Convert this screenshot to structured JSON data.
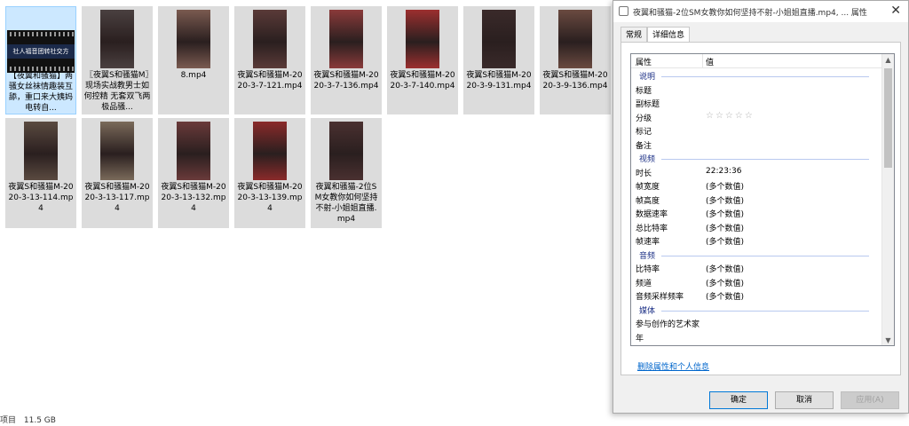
{
  "files": [
    {
      "name": "【夜翼和骚猫】两骚女丝袜情趣装互舔，重口来大姨妈电转自...",
      "band_text": "社人福音团转社交方",
      "selected": true
    },
    {
      "name": "〖夜翼S和骚猫M〗现场实战教男士如何控精 无套双飞两极品骚...",
      "selected": false
    },
    {
      "name": "8.mp4",
      "selected": false
    },
    {
      "name": "夜翼S和骚猫M-2020-3-7-121.mp4",
      "selected": false
    },
    {
      "name": "夜翼S和骚猫M-2020-3-7-136.mp4",
      "selected": false
    },
    {
      "name": "夜翼S和骚猫M-2020-3-7-140.mp4",
      "selected": false
    },
    {
      "name": "夜翼S和骚猫M-2020-3-9-131.mp4",
      "selected": false
    },
    {
      "name": "夜翼S和骚猫M-2020-3-9-136.mp4",
      "selected": false
    },
    {
      "name": "夜翼S和骚猫M-2020-3-13-114.mp4",
      "selected": false
    },
    {
      "name": "夜翼S和骚猫M-2020-3-13-117.mp4",
      "selected": false
    },
    {
      "name": "夜翼S和骚猫M-2020-3-13-132.mp4",
      "selected": false
    },
    {
      "name": "夜翼S和骚猫M-2020-3-13-139.mp4",
      "selected": false
    },
    {
      "name": "夜翼和骚猫-2位SM女教你如何坚持不射-小姐姐直播.mp4",
      "selected": false
    }
  ],
  "status_bar": {
    "items_label": "项目",
    "size": "11.5 GB"
  },
  "dialog": {
    "title": "夜翼和骚猫-2位SM女教你如何坚持不射-小姐姐直播.mp4, ... 属性",
    "close_glyph": "✕",
    "tabs": [
      {
        "label": "常规"
      },
      {
        "label": "详细信息"
      }
    ],
    "active_tab": "详细信息",
    "columns": {
      "property": "属性",
      "value": "值"
    },
    "rows": [
      {
        "type": "group",
        "name": "说明"
      },
      {
        "type": "prop",
        "name": "标题",
        "value": ""
      },
      {
        "type": "prop",
        "name": "副标题",
        "value": ""
      },
      {
        "type": "stars",
        "name": "分级",
        "value": "☆☆☆☆☆"
      },
      {
        "type": "prop",
        "name": "标记",
        "value": ""
      },
      {
        "type": "prop",
        "name": "备注",
        "value": ""
      },
      {
        "type": "group",
        "name": "视频"
      },
      {
        "type": "prop",
        "name": "时长",
        "value": "22:23:36"
      },
      {
        "type": "prop",
        "name": "帧宽度",
        "value": "(多个数值)"
      },
      {
        "type": "prop",
        "name": "帧高度",
        "value": "(多个数值)"
      },
      {
        "type": "prop",
        "name": "数据速率",
        "value": "(多个数值)"
      },
      {
        "type": "prop",
        "name": "总比特率",
        "value": "(多个数值)"
      },
      {
        "type": "prop",
        "name": "帧速率",
        "value": "(多个数值)"
      },
      {
        "type": "group",
        "name": "音频"
      },
      {
        "type": "prop",
        "name": "比特率",
        "value": "(多个数值)"
      },
      {
        "type": "prop",
        "name": "频道",
        "value": "(多个数值)"
      },
      {
        "type": "prop",
        "name": "音频采样频率",
        "value": "(多个数值)"
      },
      {
        "type": "group",
        "name": "媒体"
      },
      {
        "type": "prop",
        "name": "参与创作的艺术家",
        "value": ""
      },
      {
        "type": "prop",
        "name": "年",
        "value": ""
      }
    ],
    "scroll_up_glyph": "▲",
    "scroll_down_glyph": "▼",
    "remove_link": "删除属性和个人信息",
    "buttons": {
      "ok": "确定",
      "cancel": "取消",
      "apply": "应用(A)"
    }
  },
  "thumb_colors": [
    "#4a4040",
    "#7a5a50",
    "#5a3a38",
    "#8a3a3a",
    "#9c2f2f",
    "#3a2a2a",
    "#6a4a40",
    "#5a4a40",
    "#7a6a5a",
    "#6a3a3a",
    "#8a2a2a",
    "#4a3030"
  ]
}
